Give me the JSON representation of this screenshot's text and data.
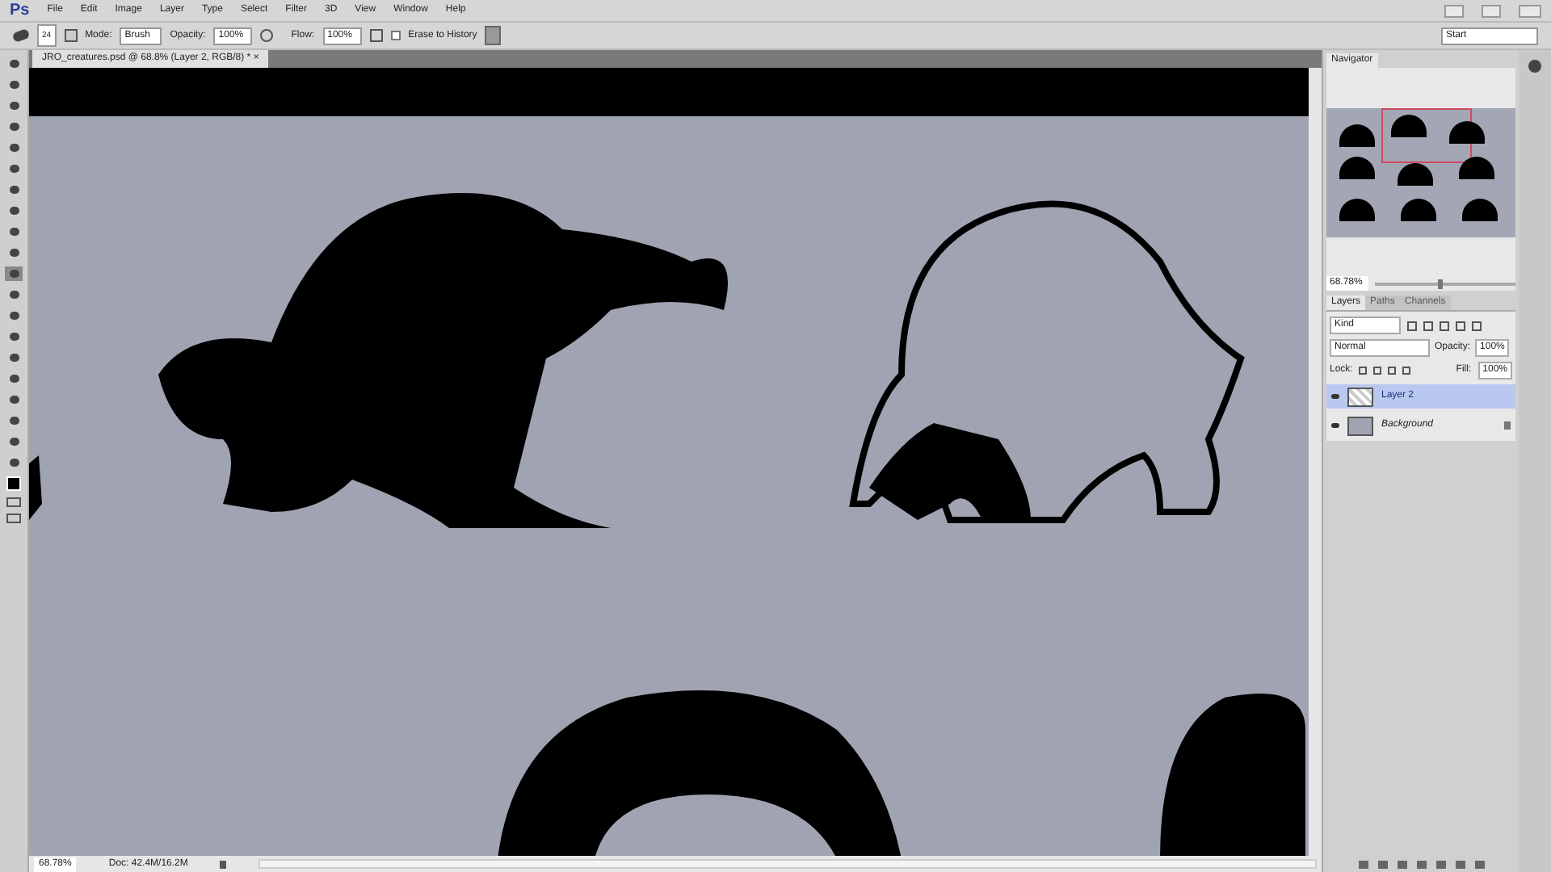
{
  "app_logo": "Ps",
  "menu": [
    "File",
    "Edit",
    "Image",
    "Layer",
    "Type",
    "Select",
    "Filter",
    "3D",
    "View",
    "Window",
    "Help"
  ],
  "options": {
    "brush_size": "24",
    "mode_label": "Mode:",
    "mode": "Brush",
    "opacity_label": "Opacity:",
    "opacity": "100%",
    "flow_label": "Flow:",
    "flow": "100%",
    "erase_to_history": {
      "label": "Erase to History",
      "checked": false
    },
    "workspace": "Start"
  },
  "document": {
    "tab_title": "JRO_creatures.psd @ 68.8% (Layer 2, RGB/8) *",
    "close": "×"
  },
  "tools": [
    {
      "selected": false
    },
    {
      "selected": false
    },
    {
      "selected": false
    },
    {
      "selected": false
    },
    {
      "selected": false
    },
    {
      "selected": false
    },
    {
      "selected": false
    },
    {
      "selected": false
    },
    {
      "selected": false
    },
    {
      "selected": false
    },
    {
      "selected": true
    },
    {
      "selected": false
    },
    {
      "selected": false
    },
    {
      "selected": false
    },
    {
      "selected": false
    },
    {
      "selected": false
    },
    {
      "selected": false
    },
    {
      "selected": false
    },
    {
      "selected": false
    },
    {
      "selected": false
    }
  ],
  "navigator": {
    "tab": "Navigator",
    "zoom": "68.78%",
    "level": 0.45
  },
  "layers_panel": {
    "tabs": [
      {
        "label": "Layers",
        "selected": true
      },
      {
        "label": "Paths",
        "selected": false
      },
      {
        "label": "Channels",
        "selected": false
      }
    ],
    "filter": "Kind",
    "blend_mode": "Normal",
    "opacity_label": "Opacity:",
    "opacity": "100%",
    "lock_label": "Lock:",
    "fill_label": "Fill:",
    "fill": "100%",
    "layers": [
      {
        "name": "Layer 2",
        "selected": true,
        "visible": true,
        "locked": false,
        "kind": "sketch"
      },
      {
        "name": "Background",
        "selected": false,
        "visible": true,
        "locked": true,
        "kind": "plain"
      }
    ]
  },
  "status_bar": {
    "zoom": "68.78%",
    "doc": "Doc: 42.4M/16.2M"
  }
}
